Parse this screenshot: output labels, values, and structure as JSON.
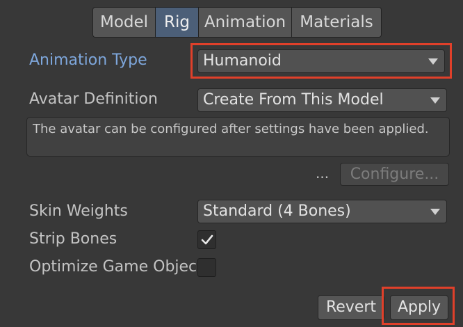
{
  "tabs": [
    {
      "label": "Model",
      "active": false
    },
    {
      "label": "Rig",
      "active": true
    },
    {
      "label": "Animation",
      "active": false
    },
    {
      "label": "Materials",
      "active": false
    }
  ],
  "animation_type": {
    "label": "Animation Type",
    "value": "Humanoid"
  },
  "avatar_definition": {
    "label": "Avatar Definition",
    "value": "Create From This Model"
  },
  "info_text": "The avatar can be configured after settings have been applied.",
  "configure": {
    "ellipsis": "...",
    "label": "Configure..."
  },
  "skin_weights": {
    "label": "Skin Weights",
    "value": "Standard (4 Bones)"
  },
  "strip_bones": {
    "label": "Strip Bones",
    "checked": true
  },
  "optimize": {
    "label": "Optimize Game Objec",
    "checked": false
  },
  "footer": {
    "revert_label": "Revert",
    "apply_label": "Apply"
  },
  "colors": {
    "accent_label": "#7ea7dc",
    "highlight_box": "#e0402a",
    "active_tab": "#4c5f78"
  }
}
